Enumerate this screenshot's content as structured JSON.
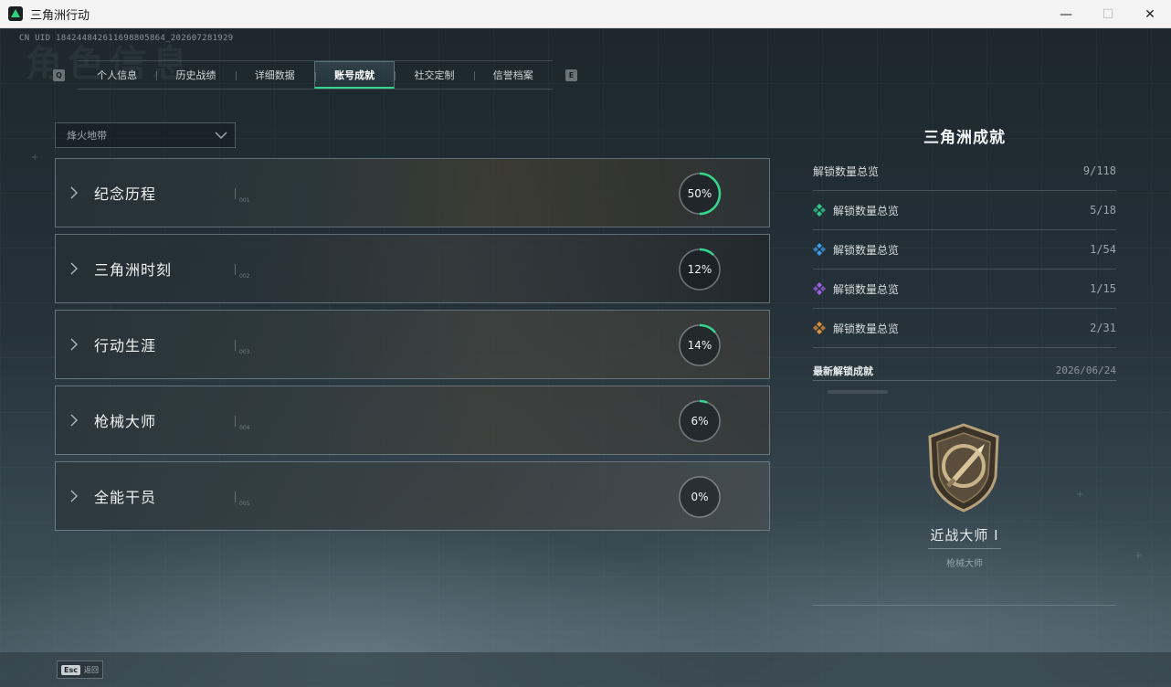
{
  "window": {
    "title": "三角洲行动",
    "minimize": "—",
    "maximize": "☐",
    "close": "✕"
  },
  "header": {
    "uid": "CN UID 1842448426116988058​64_202607281929",
    "bg_title": "角色信息"
  },
  "tabs": {
    "left_key": "Q",
    "right_key": "E",
    "items": [
      {
        "label": "个人信息",
        "active": false
      },
      {
        "label": "历史战绩",
        "active": false
      },
      {
        "label": "详细数据",
        "active": false
      },
      {
        "label": "账号成就",
        "active": true
      },
      {
        "label": "社交定制",
        "active": false
      },
      {
        "label": "信誉档案",
        "active": false
      }
    ]
  },
  "mode_select": {
    "value": "烽火地带"
  },
  "categories": [
    {
      "label": "纪念历程",
      "tag": "001",
      "percent": 50,
      "percent_text": "50%"
    },
    {
      "label": "三角洲时刻",
      "tag": "002",
      "percent": 12,
      "percent_text": "12%"
    },
    {
      "label": "行动生涯",
      "tag": "003",
      "percent": 14,
      "percent_text": "14%"
    },
    {
      "label": "枪械大师",
      "tag": "004",
      "percent": 6,
      "percent_text": "6%"
    },
    {
      "label": "全能干员",
      "tag": "005",
      "percent": 0,
      "percent_text": "0%"
    }
  ],
  "panel": {
    "title": "三角洲成就",
    "stats": [
      {
        "label": "解锁数量总览",
        "value": "9/118",
        "icon": "none"
      },
      {
        "label": "解锁数量总览",
        "value": "5/18",
        "icon": "green-gem-icon",
        "color": "#2fc98a"
      },
      {
        "label": "解锁数量总览",
        "value": "1/54",
        "icon": "blue-gem-icon",
        "color": "#3a9be8"
      },
      {
        "label": "解锁数量总览",
        "value": "1/15",
        "icon": "purple-gem-icon",
        "color": "#a05de6"
      },
      {
        "label": "解锁数量总览",
        "value": "2/31",
        "icon": "gold-gem-icon",
        "color": "#e0903a"
      }
    ],
    "latest_label": "最新解锁成就",
    "latest_date": "2026/06/24",
    "achievement": {
      "name": "近战大师 I",
      "category": "枪械大师"
    }
  },
  "footer": {
    "esc_key": "Esc",
    "esc_label": "返回"
  },
  "colors": {
    "accent": "#35d58c"
  }
}
